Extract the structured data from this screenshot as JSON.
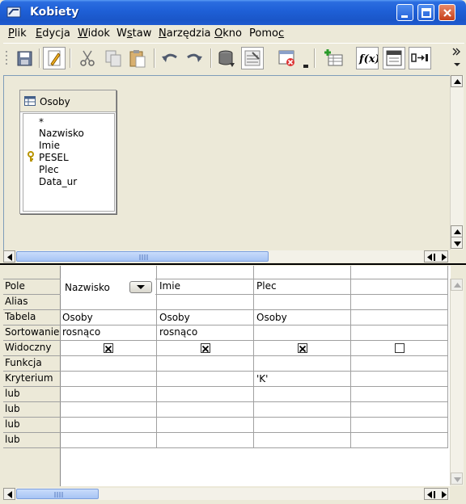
{
  "window": {
    "title": "Kobiety"
  },
  "menu": [
    {
      "label": "Plik",
      "key": "P",
      "rest": "lik"
    },
    {
      "label": "Edycja",
      "key": "E",
      "rest": "dycja"
    },
    {
      "label": "Widok",
      "key": "W",
      "rest": "idok"
    },
    {
      "label": "Wstaw",
      "pre": "W",
      "key": "s",
      "rest": "taw"
    },
    {
      "label": "Narzędzia",
      "key": "N",
      "rest": "arzędzia"
    },
    {
      "label": "Okno",
      "key": "O",
      "rest": "kno"
    },
    {
      "label": "Pomoc",
      "pre": "Pomo",
      "key": "c",
      "rest": ""
    }
  ],
  "table_box": {
    "name": "Osoby",
    "fields": [
      "*",
      "Nazwisko",
      "Imie",
      "PESEL",
      "Plec",
      "Data_ur"
    ],
    "primary_key": "PESEL"
  },
  "grid": {
    "row_labels": [
      "Pole",
      "Alias",
      "Tabela",
      "Sortowanie",
      "Widoczny",
      "Funkcja",
      "Kryterium",
      "lub",
      "lub",
      "lub",
      "lub"
    ],
    "columns": [
      {
        "pole": "Nazwisko",
        "alias": "",
        "tabela": "Osoby",
        "sortowanie": "rosnąco",
        "widoczny": true,
        "funkcja": "",
        "kryterium": ""
      },
      {
        "pole": "Imie",
        "alias": "",
        "tabela": "Osoby",
        "sortowanie": "rosnąco",
        "widoczny": true,
        "funkcja": "",
        "kryterium": ""
      },
      {
        "pole": "Plec",
        "alias": "",
        "tabela": "Osoby",
        "sortowanie": "",
        "widoczny": true,
        "funkcja": "",
        "kryterium": "'K'"
      },
      {
        "pole": "",
        "alias": "",
        "tabela": "",
        "sortowanie": "",
        "widoczny": false,
        "funkcja": "",
        "kryterium": ""
      }
    ]
  },
  "toolbar_icons": [
    "save-icon",
    "edit-mode-icon",
    "cut-icon",
    "copy-icon",
    "paste-icon",
    "undo-icon",
    "redo-icon",
    "run-query-icon",
    "clear-query-icon",
    "design-view-icon",
    "delete-icon",
    "add-table-icon",
    "functions-icon",
    "table-name-icon",
    "alias-icon",
    "distinct-values-icon"
  ],
  "colors": {
    "titlebar": "#1e5fd6",
    "chrome": "#ece9d8",
    "accent": "#a7c4f4"
  }
}
